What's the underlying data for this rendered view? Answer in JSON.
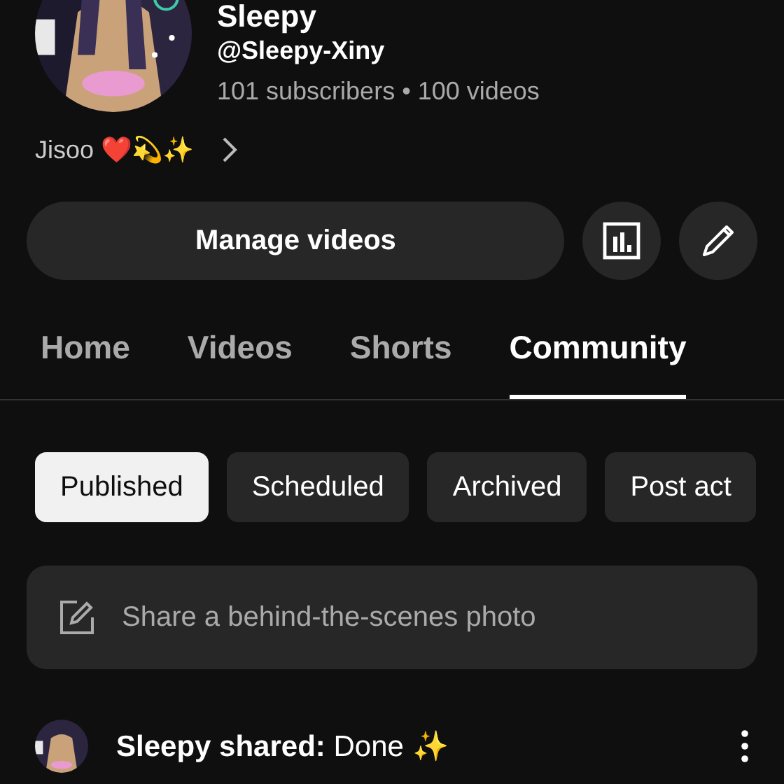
{
  "channel": {
    "name": "Sleepy",
    "handle": "@Sleepy-Xiny",
    "stats": "101 subscribers • 100 videos",
    "description": "Jisoo ❤️💫✨"
  },
  "actions": {
    "manage_label": "Manage videos"
  },
  "tabs": [
    {
      "label": "Home",
      "selected": false
    },
    {
      "label": "Videos",
      "selected": false
    },
    {
      "label": "Shorts",
      "selected": false
    },
    {
      "label": "Community",
      "selected": true
    }
  ],
  "filters": [
    {
      "label": "Published",
      "selected": true
    },
    {
      "label": "Scheduled",
      "selected": false
    },
    {
      "label": "Archived",
      "selected": false
    },
    {
      "label": "Post act",
      "selected": false
    }
  ],
  "composer": {
    "placeholder": "Share a behind-the-scenes photo"
  },
  "post": {
    "text": "**Sleepy shared:** Done ✨"
  }
}
